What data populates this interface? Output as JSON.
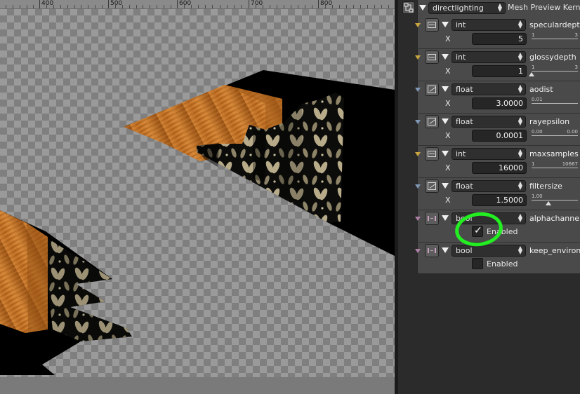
{
  "ruler": {
    "ticks": [
      "400",
      "500",
      "600",
      "700",
      "800"
    ]
  },
  "header": {
    "kernel_select": "directlighting",
    "title": "Mesh Preview Kernel",
    "icon": "node-tree-icon"
  },
  "params": [
    {
      "type": "int",
      "name": "speculardepth",
      "axis": "X",
      "value": "5",
      "min": "1",
      "max": "3",
      "marker_color": "#c9a640",
      "icon": "integer-icon"
    },
    {
      "type": "int",
      "name": "glossydepth",
      "axis": "X",
      "value": "1",
      "min": "1",
      "max": "3",
      "marker_color": "#c9a640",
      "icon": "integer-icon"
    },
    {
      "type": "float",
      "name": "aodist",
      "axis": "X",
      "value": "3.0000",
      "min": "0.01",
      "max": "",
      "marker_color": "#7f98b5",
      "icon": "float-icon"
    },
    {
      "type": "float",
      "name": "rayepsilon",
      "axis": "X",
      "value": "0.0001",
      "min": "0.00",
      "max": "0.00",
      "marker_color": "#7f98b5",
      "icon": "float-icon"
    },
    {
      "type": "int",
      "name": "maxsamples",
      "axis": "X",
      "value": "16000",
      "min": "1",
      "max": "10667",
      "marker_color": "#c9a640",
      "icon": "integer-icon"
    },
    {
      "type": "float",
      "name": "filtersize",
      "axis": "X",
      "value": "1.5000",
      "min": "1.00",
      "max": "",
      "marker_color": "#7f98b5",
      "icon": "float-icon"
    },
    {
      "type": "bool",
      "name": "alphachannel",
      "checkbox_label": "Enabled",
      "checked": true,
      "marker_color": "#b07fa6",
      "icon": "bool-icon"
    },
    {
      "type": "bool",
      "name": "keep_environm",
      "checkbox_label": "Enabled",
      "checked": false,
      "marker_color": "#b07fa6",
      "icon": "bool-icon"
    }
  ]
}
